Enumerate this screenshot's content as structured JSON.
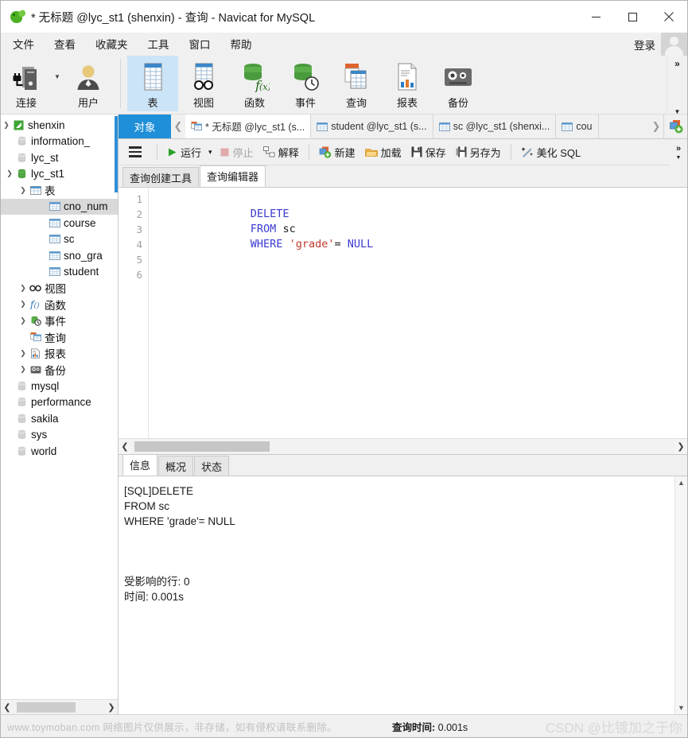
{
  "window": {
    "title": "* 无标题 @lyc_st1 (shenxin) - 查询 - Navicat for MySQL",
    "logo_icon": "navicat-logo-icon",
    "minimize_icon": "minimize-icon",
    "maximize_icon": "maximize-icon",
    "close_icon": "close-icon"
  },
  "menubar": {
    "items": [
      {
        "label": "文件",
        "name": "menu-file"
      },
      {
        "label": "查看",
        "name": "menu-view"
      },
      {
        "label": "收藏夹",
        "name": "menu-favorites"
      },
      {
        "label": "工具",
        "name": "menu-tools"
      },
      {
        "label": "窗口",
        "name": "menu-window"
      },
      {
        "label": "帮助",
        "name": "menu-help"
      }
    ],
    "login_label": "登录",
    "avatar_icon": "user-avatar-icon"
  },
  "toolbar": {
    "items": [
      {
        "label": "连接",
        "icon": "connection-icon",
        "active": false
      },
      {
        "label": "用户",
        "icon": "user-icon",
        "active": false
      },
      {
        "label": "表",
        "icon": "table-icon",
        "active": true
      },
      {
        "label": "视图",
        "icon": "view-icon",
        "active": false
      },
      {
        "label": "函数",
        "icon": "function-icon",
        "active": false
      },
      {
        "label": "事件",
        "icon": "event-icon",
        "active": false
      },
      {
        "label": "查询",
        "icon": "query-icon",
        "active": false
      },
      {
        "label": "报表",
        "icon": "report-icon",
        "active": false
      },
      {
        "label": "备份",
        "icon": "backup-icon",
        "active": false
      }
    ],
    "dropdown_caret_icon": "caret-down-icon",
    "overflow_icon": "chevron-double-right-icon",
    "expand_icon": "caret-down-icon"
  },
  "sidebar": {
    "tree": [
      {
        "label": "shenxin",
        "depth": 0,
        "icon": "connection-node-icon",
        "twist": "expanded",
        "selected": false
      },
      {
        "label": "information_",
        "depth": 1,
        "icon": "database-grey-icon",
        "twist": "none",
        "selected": false
      },
      {
        "label": "lyc_st",
        "depth": 1,
        "icon": "database-grey-icon",
        "twist": "none",
        "selected": false
      },
      {
        "label": "lyc_st1",
        "depth": 1,
        "icon": "database-green-icon",
        "twist": "expanded",
        "selected": false
      },
      {
        "label": "表",
        "depth": 2,
        "icon": "table-folder-icon",
        "twist": "expanded",
        "selected": false
      },
      {
        "label": "cno_num",
        "depth": 3,
        "icon": "table-item-icon",
        "twist": "none",
        "selected": true
      },
      {
        "label": "course",
        "depth": 3,
        "icon": "table-item-icon",
        "twist": "none",
        "selected": false
      },
      {
        "label": "sc",
        "depth": 3,
        "icon": "table-item-icon",
        "twist": "none",
        "selected": false
      },
      {
        "label": "sno_gra",
        "depth": 3,
        "icon": "table-item-icon",
        "twist": "none",
        "selected": false
      },
      {
        "label": "student",
        "depth": 3,
        "icon": "table-item-icon",
        "twist": "none",
        "selected": false
      },
      {
        "label": "视图",
        "depth": 2,
        "icon": "view-node-icon",
        "twist": "collapsed",
        "selected": false
      },
      {
        "label": "函数",
        "depth": 2,
        "icon": "function-node-icon",
        "twist": "collapsed",
        "selected": false
      },
      {
        "label": "事件",
        "depth": 2,
        "icon": "event-node-icon",
        "twist": "collapsed",
        "selected": false
      },
      {
        "label": "查询",
        "depth": 2,
        "icon": "query-node-icon",
        "twist": "none",
        "selected": false
      },
      {
        "label": "报表",
        "depth": 2,
        "icon": "report-node-icon",
        "twist": "collapsed",
        "selected": false
      },
      {
        "label": "备份",
        "depth": 2,
        "icon": "backup-node-icon",
        "twist": "collapsed",
        "selected": false
      },
      {
        "label": "mysql",
        "depth": 1,
        "icon": "database-grey-icon",
        "twist": "none",
        "selected": false
      },
      {
        "label": "performance",
        "depth": 1,
        "icon": "database-grey-icon",
        "twist": "none",
        "selected": false
      },
      {
        "label": "sakila",
        "depth": 1,
        "icon": "database-grey-icon",
        "twist": "none",
        "selected": false
      },
      {
        "label": "sys",
        "depth": 1,
        "icon": "database-grey-icon",
        "twist": "none",
        "selected": false
      },
      {
        "label": "world",
        "depth": 1,
        "icon": "database-grey-icon",
        "twist": "none",
        "selected": false
      }
    ],
    "scroll_left_icon": "chevron-left-icon",
    "scroll_right_icon": "chevron-right-icon"
  },
  "tabstrip": {
    "objects_label": "对象",
    "prev_icon": "chevron-left-icon",
    "next_icon": "chevron-right-icon",
    "new_tab_icon": "new-tab-plus-icon",
    "tabs": [
      {
        "label": "* 无标题 @lyc_st1 (s...",
        "icon": "query-tab-icon",
        "active": true
      },
      {
        "label": "student @lyc_st1 (s...",
        "icon": "table-tab-icon",
        "active": false
      },
      {
        "label": "sc @lyc_st1 (shenxi...",
        "icon": "table-tab-icon",
        "active": false
      },
      {
        "label": "cou",
        "icon": "table-tab-icon",
        "active": false
      }
    ]
  },
  "query_toolbar": {
    "menu_icon": "hamburger-icon",
    "buttons": [
      {
        "label": "运行",
        "icon": "play-icon",
        "disabled": false,
        "has_caret": true
      },
      {
        "label": "停止",
        "icon": "stop-icon",
        "disabled": true,
        "has_caret": false
      },
      {
        "label": "解释",
        "icon": "explain-icon",
        "disabled": false,
        "has_caret": false
      },
      {
        "label": "新建",
        "icon": "new-icon",
        "disabled": false,
        "has_caret": false
      },
      {
        "label": "加载",
        "icon": "load-icon",
        "disabled": false,
        "has_caret": false
      },
      {
        "label": "保存",
        "icon": "save-icon",
        "disabled": false,
        "has_caret": false
      },
      {
        "label": "另存为",
        "icon": "save-as-icon",
        "disabled": false,
        "has_caret": false
      },
      {
        "label": "美化 SQL",
        "icon": "beautify-icon",
        "disabled": false,
        "has_caret": false
      }
    ],
    "overflow_icon": "chevron-double-right-icon",
    "expand_icon": "caret-down-icon"
  },
  "editor": {
    "subtabs": [
      {
        "label": "查询创建工具",
        "active": false
      },
      {
        "label": "查询编辑器",
        "active": true
      }
    ],
    "line_numbers": [
      "1",
      "2",
      "3",
      "4",
      "5",
      "6"
    ],
    "lines": [
      {
        "tokens": [
          {
            "t": "DELETE",
            "c": "kw"
          }
        ]
      },
      {
        "tokens": [
          {
            "t": "FROM",
            "c": "kw"
          },
          {
            "t": " sc",
            "c": "pl"
          }
        ]
      },
      {
        "tokens": [
          {
            "t": "WHERE",
            "c": "kw"
          },
          {
            "t": " ",
            "c": "pl"
          },
          {
            "t": "'grade'",
            "c": "str"
          },
          {
            "t": "= ",
            "c": "pl"
          },
          {
            "t": "NULL",
            "c": "kw"
          }
        ]
      },
      {
        "tokens": []
      },
      {
        "tokens": []
      },
      {
        "tokens": []
      }
    ]
  },
  "results": {
    "tabs": [
      {
        "label": "信息",
        "active": true
      },
      {
        "label": "概况",
        "active": false
      },
      {
        "label": "状态",
        "active": false
      }
    ],
    "lines": [
      "[SQL]DELETE",
      "FROM sc",
      "WHERE 'grade'= NULL",
      "",
      "",
      "",
      "受影响的行: 0",
      "时间: 0.001s"
    ],
    "scroll_up_icon": "caret-up-icon",
    "scroll_down_icon": "caret-down-icon"
  },
  "statusbar": {
    "watermark_left": "www.toymoban.com 网络图片仅供展示，非存储，如有侵权请联系删除。",
    "query_time_label": "查询时间:",
    "query_time_value": "0.001s",
    "watermark_right": "CSDN @比镀加之于你"
  },
  "colors": {
    "accent_blue": "#1e8fd8",
    "toolbar_active": "#cce4f7",
    "tree_selected": "#d9d9d9",
    "keyword": "#3a3ad0",
    "string": "#c0392b",
    "chrome": "#f0f0f0"
  }
}
